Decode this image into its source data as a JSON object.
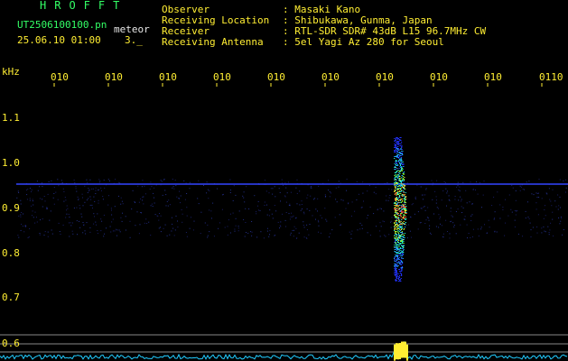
{
  "header": {
    "title": "HROFFT",
    "filename": "UT2506100100.pn",
    "detection": "meteor",
    "datetime": "25.06.10 01:00",
    "count": "3._"
  },
  "info": [
    {
      "label": "Observer",
      "value": ": Masaki Kano"
    },
    {
      "label": "Receiving Location",
      "value": ": Shibukawa, Gunma, Japan"
    },
    {
      "label": "Receiver",
      "value": ": RTL-SDR SDR# 43dB L15 96.7MHz CW"
    },
    {
      "label": "Receiving Antenna",
      "value": ": 5el Yagi Az 280 for Seoul"
    }
  ],
  "time_ticks": [
    "010",
    "010",
    "010",
    "010",
    "010",
    "010",
    "010",
    "010",
    "010",
    "0110"
  ],
  "freq_axis": {
    "unit": "kHz",
    "labels": [
      "1.1",
      "1.0",
      "0.9",
      "0.8",
      "0.7",
      "0.6"
    ]
  },
  "colors": {
    "background": "#000000",
    "text_green": "#33ff66",
    "text_white": "#e8e8e8",
    "text_yellow": "#ffee33",
    "carrier": "#3344ff",
    "echo": "#ff3344",
    "baseline": "#22ccff"
  }
}
